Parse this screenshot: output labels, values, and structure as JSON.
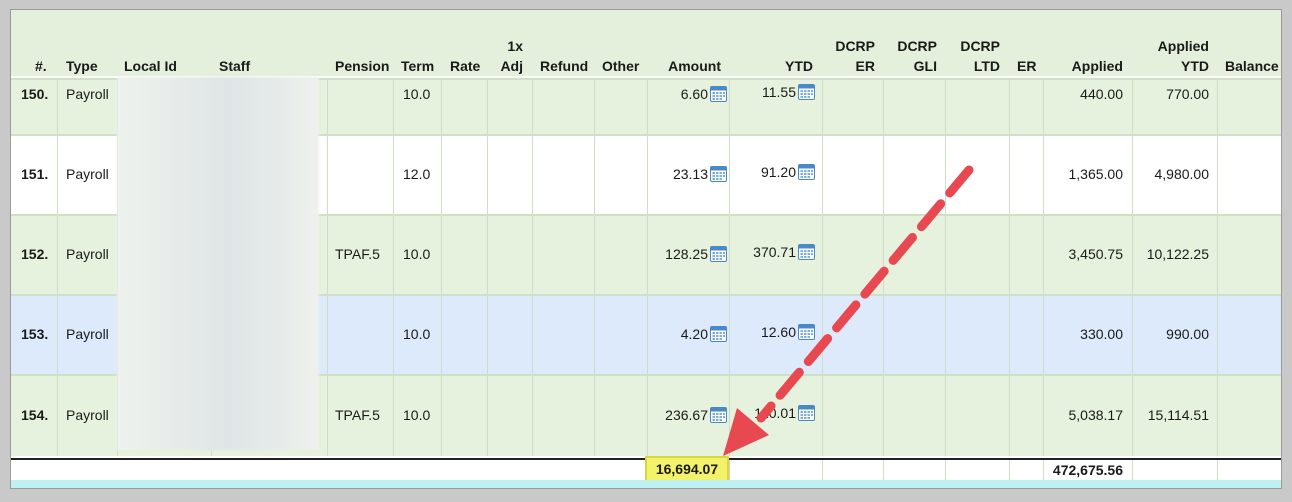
{
  "columns": {
    "num": "#.",
    "type": "Type",
    "local_id": "Local Id",
    "staff": "Staff",
    "pension": "Pension",
    "term": "Term",
    "rate": "Rate",
    "adj_line1": "1x",
    "adj_line2": "Adj",
    "refund": "Refund",
    "other": "Other",
    "amount": "Amount",
    "ytd": "YTD",
    "dcrp_er_line1": "DCRP",
    "dcrp_er_line2": "ER",
    "dcrp_gli_line1": "DCRP",
    "dcrp_gli_line2": "GLI",
    "dcrp_ltd_line1": "DCRP",
    "dcrp_ltd_line2": "LTD",
    "er": "ER",
    "applied": "Applied",
    "applied_ytd_line1": "Applied",
    "applied_ytd_line2": "YTD",
    "balance": "Balance"
  },
  "rows": [
    {
      "num": "150.",
      "type": "Payroll",
      "pension": "",
      "term": "10.0",
      "amount": "6.60",
      "ytd": "11.55",
      "applied": "440.00",
      "applied_ytd": "770.00",
      "bg": "#e6f1de"
    },
    {
      "num": "151.",
      "type": "Payroll",
      "pension": "",
      "term": "12.0",
      "amount": "23.13",
      "ytd": "91.20",
      "applied": "1,365.00",
      "applied_ytd": "4,980.00",
      "bg": "#ffffff"
    },
    {
      "num": "152.",
      "type": "Payroll",
      "pension": "TPAF.5",
      "term": "10.0",
      "amount": "128.25",
      "ytd": "370.71",
      "applied": "3,450.75",
      "applied_ytd": "10,122.25",
      "bg": "#e6f1de"
    },
    {
      "num": "153.",
      "type": "Payroll",
      "pension": "",
      "term": "10.0",
      "amount": "4.20",
      "ytd": "12.60",
      "applied": "330.00",
      "applied_ytd": "990.00",
      "bg": "#dceafb"
    },
    {
      "num": "154.",
      "type": "Payroll",
      "pension": "TPAF.5",
      "term": "10.0",
      "amount": "236.67",
      "ytd": "110.01",
      "applied": "5,038.17",
      "applied_ytd": "15,114.51",
      "bg": "#e6f1de"
    }
  ],
  "totals": {
    "amount": "16,694.07",
    "applied": "472,675.56"
  },
  "icons": {
    "row_icon": "calendar-icon"
  },
  "colors": {
    "header_bg": "#e4efdc",
    "highlight": "#f4f26a",
    "arrow": "#e8484f"
  }
}
